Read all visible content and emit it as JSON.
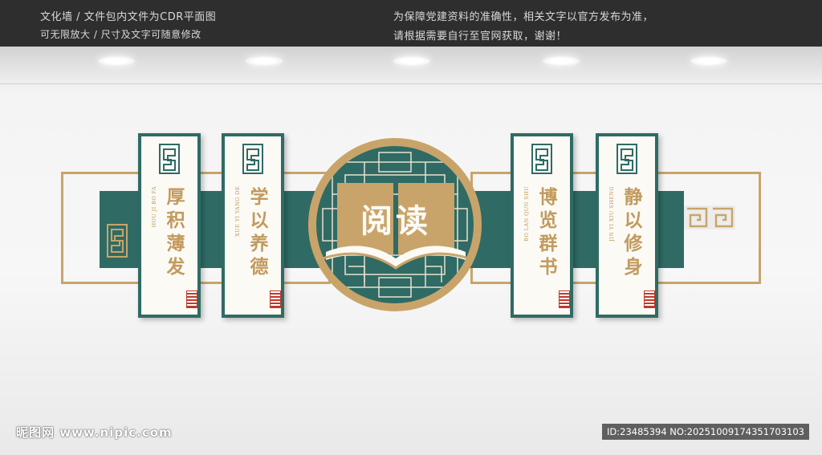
{
  "header": {
    "line1_left": "文化墙 / 文件包内文件为CDR平面图",
    "line2_left": "可无限放大 / 尺寸及文字可随意修改",
    "line1_right": "为保障党建资料的准确性，相关文字以官方发布为准，",
    "line2_right": "请根据需要自行至官网获取，谢谢！"
  },
  "center": {
    "title": "阅读"
  },
  "panels": [
    {
      "text": "厚积薄发",
      "pinyin": "HOU JI BO FA"
    },
    {
      "text": "学以养德",
      "pinyin": "XUE YI YANG DE"
    },
    {
      "text": "博览群书",
      "pinyin": "BO LAN QUN SHU"
    },
    {
      "text": "静以修身",
      "pinyin": "JIN YI XIU SHENG"
    }
  ],
  "watermark": {
    "left": "昵图网 www.nipic.com",
    "right": "ID:23485394 NO:20251009174351703103"
  },
  "colors": {
    "teal": "#2f6b64",
    "gold": "#c9a46a",
    "cream": "#fbfaf5",
    "seal": "#c0392b"
  }
}
